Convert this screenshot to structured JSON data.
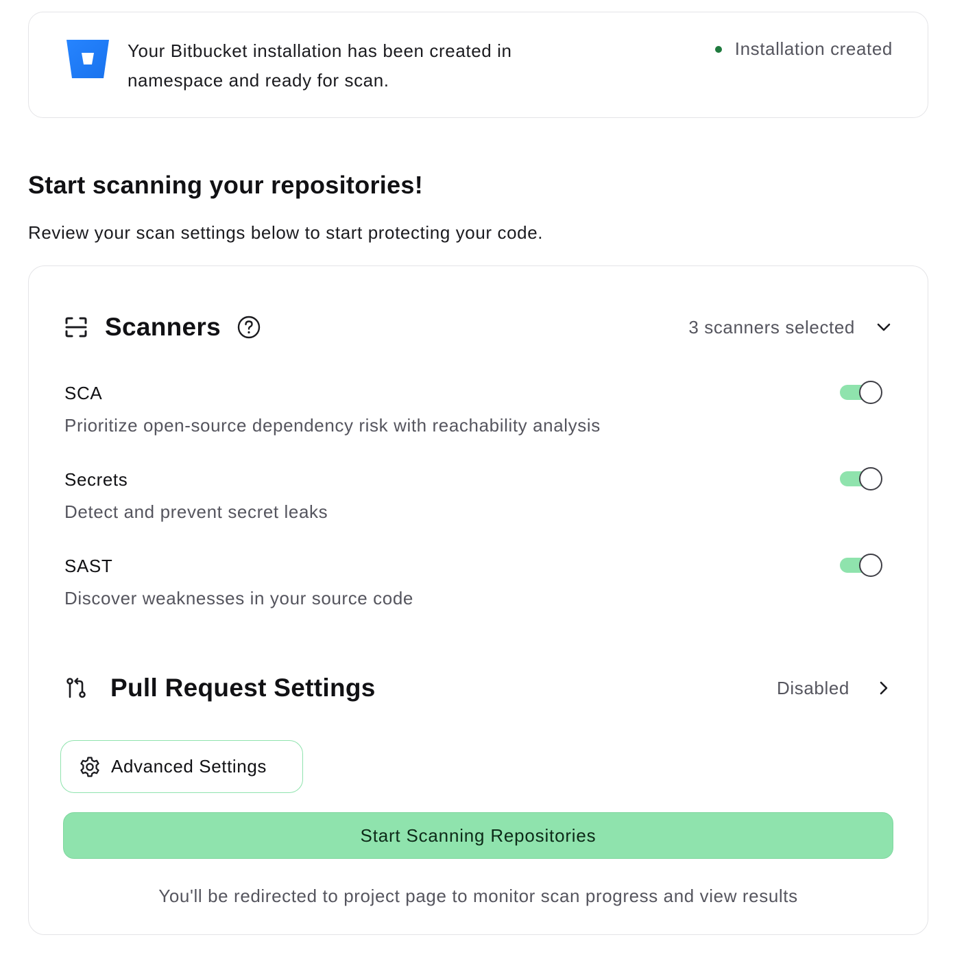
{
  "banner": {
    "message_line1": "Your Bitbucket installation has been created in",
    "message_line2": "namespace and ready for scan.",
    "status_label": "Installation created",
    "status_color": "#1f7a3e",
    "logo_icon": "bitbucket-logo"
  },
  "intro": {
    "title": "Start scanning your repositories!",
    "subtitle": "Review your scan settings below to start protecting your code."
  },
  "scanners": {
    "title": "Scanners",
    "icon": "scan-frame-icon",
    "help_icon": "question-circle-icon",
    "summary": "3 scanners selected",
    "items": [
      {
        "name": "SCA",
        "description": "Prioritize open-source dependency risk with reachability analysis",
        "enabled": true
      },
      {
        "name": "Secrets",
        "description": "Detect and prevent secret leaks",
        "enabled": true
      },
      {
        "name": "SAST",
        "description": "Discover weaknesses in your source code",
        "enabled": true
      }
    ]
  },
  "pull_request": {
    "title": "Pull Request Settings",
    "icon": "pull-request-icon",
    "status": "Disabled"
  },
  "actions": {
    "advanced_label": "Advanced Settings",
    "start_label": "Start Scanning Repositories",
    "footnote": "You'll be redirected to project page to monitor scan progress and view results"
  },
  "colors": {
    "accent": "#8fe3ad",
    "text_muted": "#55555e"
  }
}
